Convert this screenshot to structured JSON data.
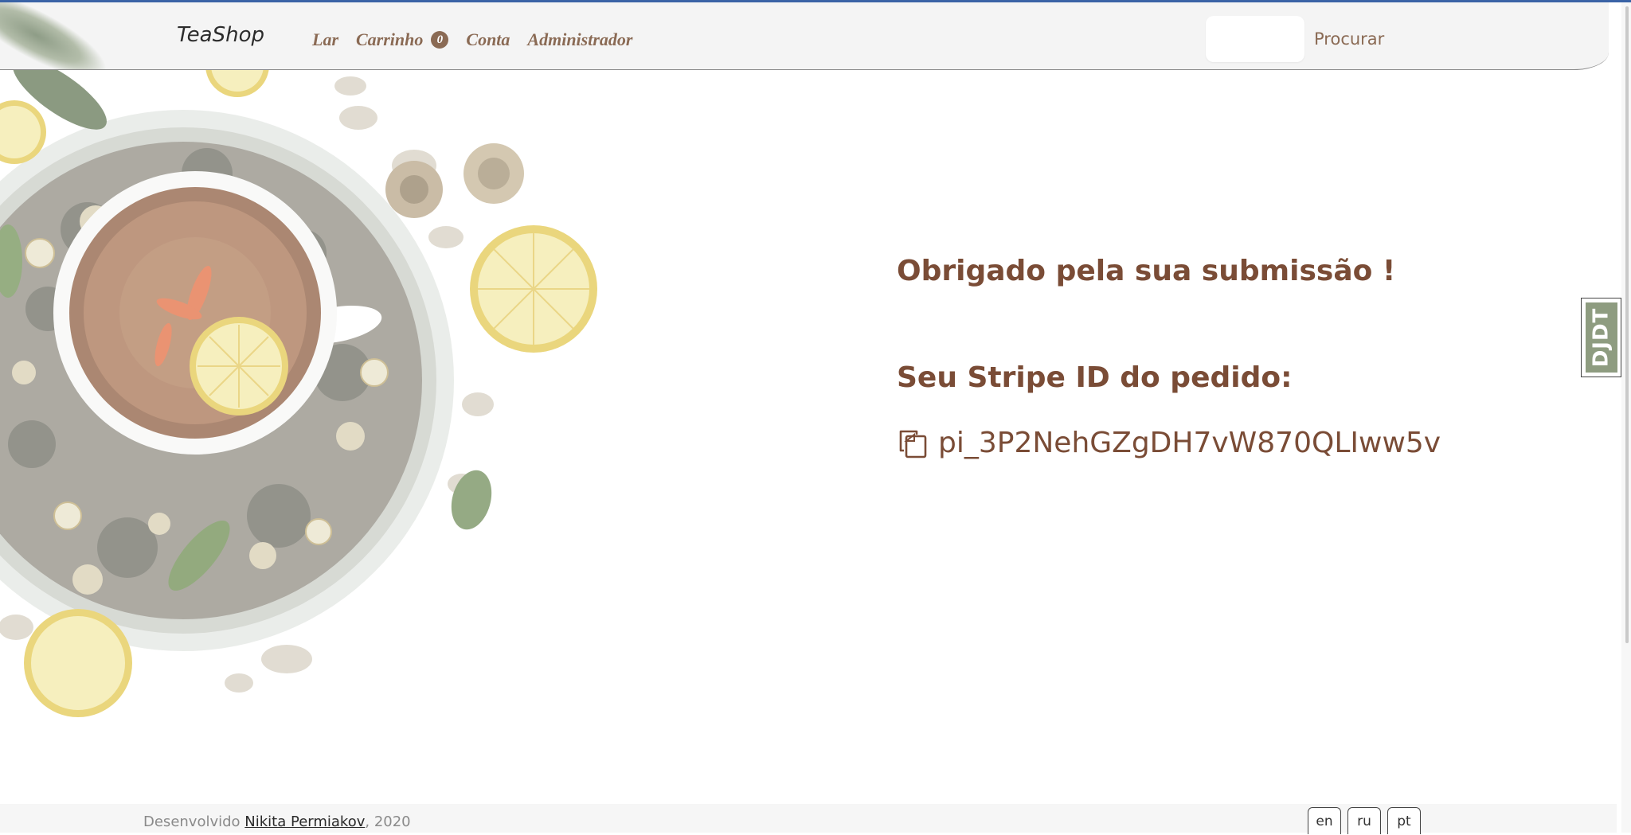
{
  "navbar": {
    "brand": "TeaShop",
    "links": {
      "home": "Lar",
      "cart": "Carrinho",
      "account": "Conta",
      "admin": "Administrador"
    },
    "cart_count": "0",
    "search_value": "",
    "search_button": "Procurar"
  },
  "main": {
    "thanks": "Obrigado pela sua submissão !",
    "order_label": "Seu Stripe ID do pedido:",
    "order_id": "pi_3P2NehGZgDH7vW870QLIww5v",
    "copy_icon": "copy-icon"
  },
  "debug_toolbar": {
    "label": "DJDT"
  },
  "footer": {
    "credit_prefix": "Desenvolvido ",
    "author": "Nikita Permiakov",
    "credit_suffix": ", 2020",
    "languages": [
      "en",
      "ru",
      "pt"
    ]
  },
  "colors": {
    "accent_brown": "#7a4c36",
    "nav_brown": "#8a6a54",
    "djdt_green": "#8e9c80",
    "top_line_blue": "#3a63a6"
  }
}
